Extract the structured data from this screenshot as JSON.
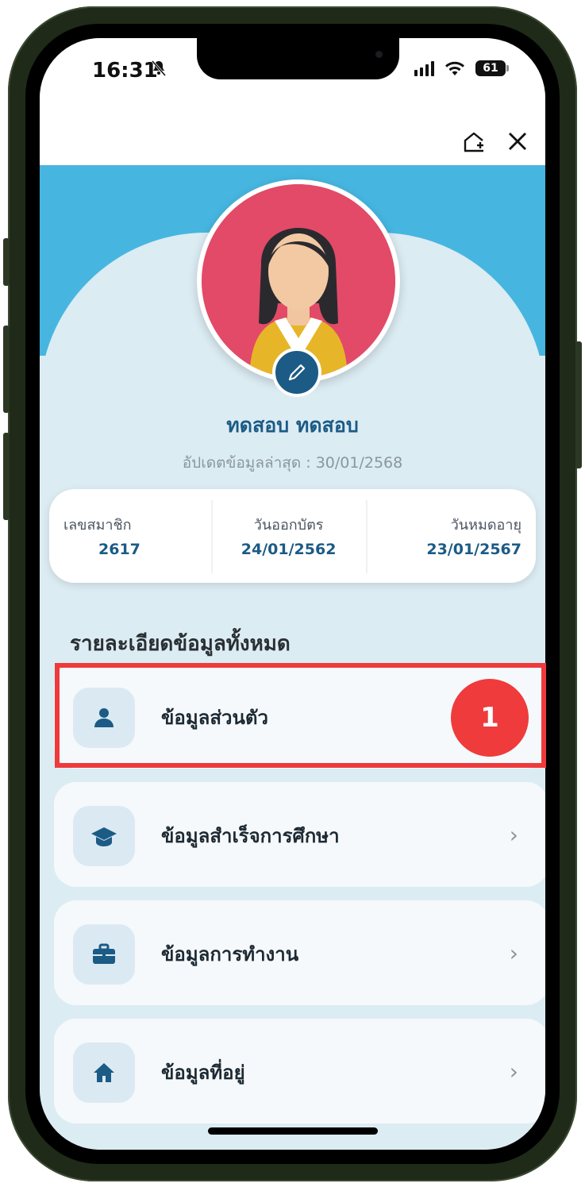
{
  "status_bar": {
    "time": "16:31",
    "battery": "61"
  },
  "header": {
    "add_to_home_icon": "add-to-home-icon",
    "close_icon": "close-icon"
  },
  "profile": {
    "name": "ทดสอบ ทดสอบ",
    "last_updated": "อัปเดตข้อมูลล่าสุด : 30/01/2568",
    "edit_icon": "pencil-icon"
  },
  "info": [
    {
      "label": "เลขสมาชิก",
      "value": "2617"
    },
    {
      "label": "วันออกบัตร",
      "value": "24/01/2562"
    },
    {
      "label": "วันหมดอายุ",
      "value": "23/01/2567"
    }
  ],
  "section_title": "รายละเอียดข้อมูลทั้งหมด",
  "menu": [
    {
      "label": "ข้อมูลส่วนตัว",
      "icon": "person-icon"
    },
    {
      "label": "ข้อมูลสำเร็จการศึกษา",
      "icon": "graduation-cap-icon"
    },
    {
      "label": "ข้อมูลการทำงาน",
      "icon": "briefcase-icon"
    },
    {
      "label": "ข้อมูลที่อยู่",
      "icon": "home-icon"
    }
  ],
  "annotation": {
    "number": "1"
  },
  "colors": {
    "accent": "#1b5b86",
    "banner": "#46b6e0",
    "highlight": "#ee3a3c"
  }
}
